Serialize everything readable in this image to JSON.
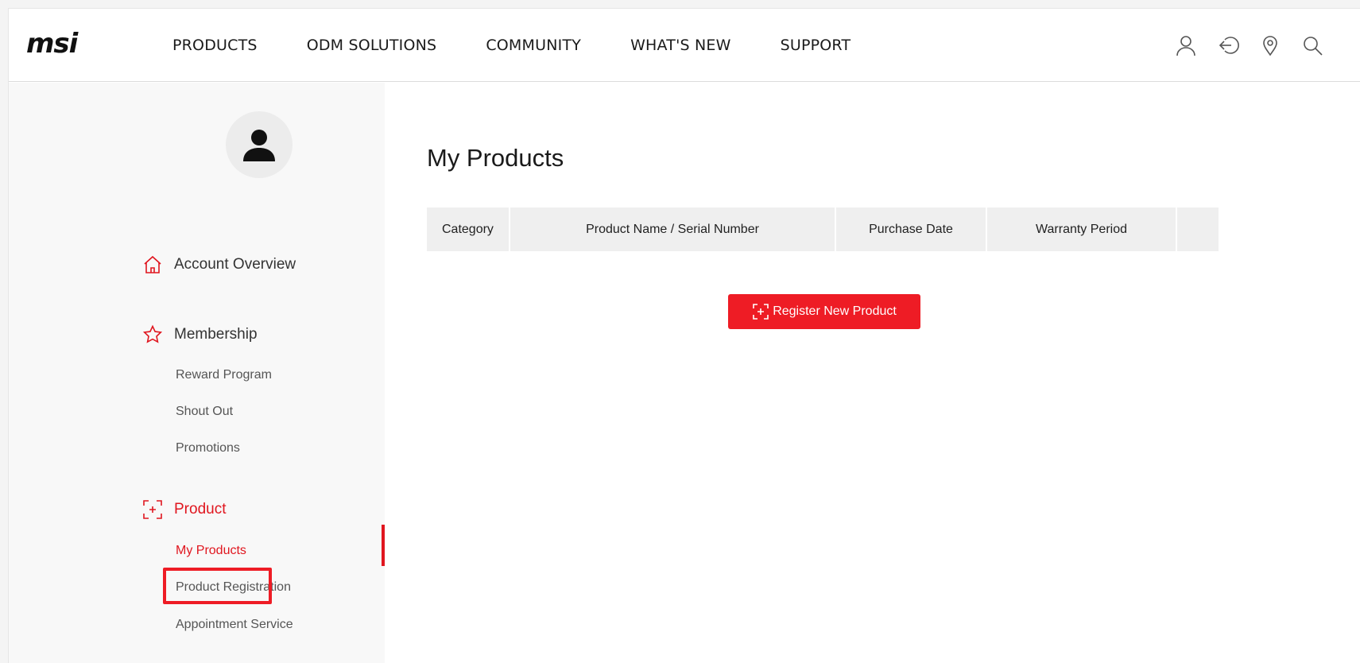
{
  "header": {
    "logo_text": "msi",
    "nav": [
      "PRODUCTS",
      "ODM SOLUTIONS",
      "COMMUNITY",
      "WHAT'S NEW",
      "SUPPORT"
    ],
    "icons": [
      "user-icon",
      "logout-icon",
      "location-icon",
      "search-icon"
    ]
  },
  "sidebar": {
    "sections": {
      "account": {
        "label": "Account Overview",
        "icon": "home-icon"
      },
      "membership": {
        "label": "Membership",
        "icon": "star-icon",
        "items": [
          "Reward Program",
          "Shout Out",
          "Promotions"
        ]
      },
      "product": {
        "label": "Product",
        "icon": "product-register-icon",
        "items": [
          "My Products",
          "Product Registration",
          "Appointment Service"
        ]
      }
    }
  },
  "main": {
    "title": "My Products",
    "table": {
      "columns": [
        "Category",
        "Product Name / Serial Number",
        "Purchase Date",
        "Warranty Period",
        ""
      ]
    },
    "register_button": "Register New Product"
  },
  "colors": {
    "accent": "#ee1c25",
    "sidebar_bg": "#f8f8f8",
    "table_header_bg": "#efefef"
  }
}
